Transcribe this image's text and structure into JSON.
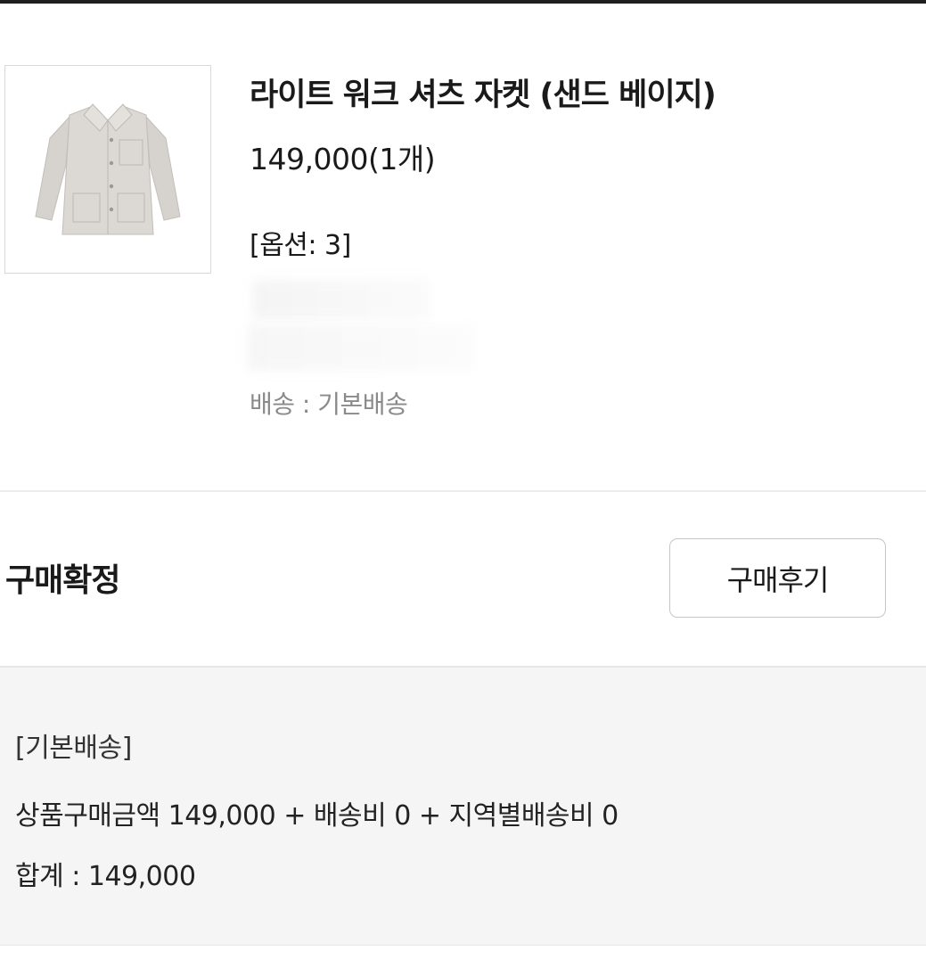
{
  "product": {
    "title": "라이트 워크 셔츠 자켓 (샌드 베이지)",
    "price": "149,000(1개)",
    "option": "[옵션: 3]",
    "shipping": "배송 : 기본배송",
    "image_icon": "jacket-image"
  },
  "order_status": {
    "label": "구매확정",
    "review_button": "구매후기"
  },
  "summary": {
    "shipping_type": "[기본배송]",
    "breakdown": "상품구매금액 149,000 + 배송비 0 + 지역별배송비 0",
    "total": "합계 : 149,000"
  }
}
